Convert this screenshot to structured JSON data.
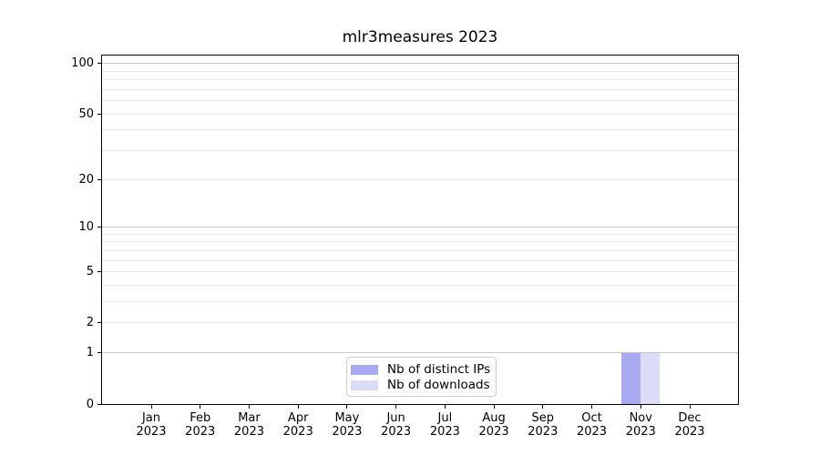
{
  "chart_data": {
    "type": "bar",
    "title": "mlr3measures 2023",
    "categories": [
      "Jan 2023",
      "Feb 2023",
      "Mar 2023",
      "Apr 2023",
      "May 2023",
      "Jun 2023",
      "Jul 2023",
      "Aug 2023",
      "Sep 2023",
      "Oct 2023",
      "Nov 2023",
      "Dec 2023"
    ],
    "series": [
      {
        "name": "Nb of distinct IPs",
        "color": "#a9a9f1",
        "values": [
          0,
          0,
          0,
          0,
          0,
          0,
          0,
          0,
          0,
          0,
          1,
          0
        ]
      },
      {
        "name": "Nb of downloads",
        "color": "#dcdcf8",
        "values": [
          0,
          0,
          0,
          0,
          0,
          0,
          0,
          0,
          0,
          0,
          1,
          0
        ]
      }
    ],
    "xlabel": "",
    "ylabel": "",
    "yscale": "log1p",
    "ylim": [
      0,
      111
    ],
    "yticks": [
      0,
      1,
      2,
      5,
      10,
      20,
      50,
      100
    ],
    "grid_major": [
      1,
      10,
      100
    ],
    "grid_minor": [
      2,
      3,
      4,
      5,
      6,
      7,
      8,
      9,
      20,
      30,
      40,
      50,
      60,
      70,
      80,
      90
    ],
    "legend_position": "lower center"
  },
  "style_colors": {
    "background": "#ffffff",
    "spine": "#000000",
    "major_grid": "#c6c6c6",
    "minor_grid": "#e9e9e9",
    "legend_border": "#cccccc",
    "bar_distinct_ips": "#a9a9f1",
    "bar_downloads": "#dcdcf8"
  }
}
